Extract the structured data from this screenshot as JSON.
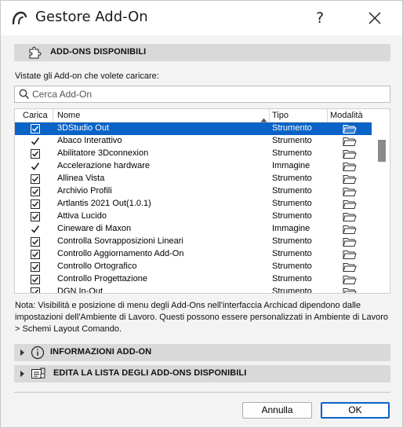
{
  "window": {
    "title": "Gestore Add-On",
    "help_label": "?"
  },
  "sections": {
    "available": "ADD-ONS DISPONIBILI",
    "info": "INFORMAZIONI ADD-ON",
    "edit_list": "EDITA LA LISTA DEGLI ADD-ONS DISPONIBILI"
  },
  "instructions": "Vistate gli Add-on che volete caricare:",
  "search": {
    "placeholder": "Cerca Add-On",
    "value": ""
  },
  "table": {
    "columns": [
      "Carica",
      "Nome",
      "Tipo",
      "Modalità"
    ],
    "sort_column": "Nome",
    "rows": [
      {
        "load": "checkbox-checked",
        "name": "3DStudio Out",
        "type": "Strumento",
        "mode": "folder-icon",
        "selected": true
      },
      {
        "load": "check",
        "name": "Abaco Interattivo",
        "type": "Strumento",
        "mode": "folder-icon"
      },
      {
        "load": "checkbox-checked",
        "name": "Abilitatore 3Dconnexion",
        "type": "Strumento",
        "mode": "folder-icon"
      },
      {
        "load": "check",
        "name": "Accelerazione hardware",
        "type": "Immagine",
        "mode": "folder-icon"
      },
      {
        "load": "checkbox-checked",
        "name": "Allinea Vista",
        "type": "Strumento",
        "mode": "folder-icon"
      },
      {
        "load": "checkbox-checked",
        "name": "Archivio Profili",
        "type": "Strumento",
        "mode": "folder-icon"
      },
      {
        "load": "checkbox-checked",
        "name": "Artlantis 2021 Out(1.0.1)",
        "type": "Strumento",
        "mode": "folder-icon"
      },
      {
        "load": "checkbox-checked",
        "name": "Attiva Lucido",
        "type": "Strumento",
        "mode": "folder-icon"
      },
      {
        "load": "check",
        "name": "Cineware di Maxon",
        "type": "Immagine",
        "mode": "folder-icon"
      },
      {
        "load": "checkbox-checked",
        "name": "Controlla Sovrapposizioni Lineari",
        "type": "Strumento",
        "mode": "folder-icon"
      },
      {
        "load": "checkbox-checked",
        "name": "Controllo Aggiornamento Add-On",
        "type": "Strumento",
        "mode": "folder-icon"
      },
      {
        "load": "checkbox-checked",
        "name": "Controllo Ortografico",
        "type": "Strumento",
        "mode": "folder-icon"
      },
      {
        "load": "checkbox-checked",
        "name": "Controllo Progettazione",
        "type": "Strumento",
        "mode": "folder-icon"
      },
      {
        "load": "checkbox-checked",
        "name": "DGN In-Out",
        "type": "Strumento",
        "mode": "folder-icon"
      }
    ],
    "scroll_position": 0.19
  },
  "note": "Nota: Visibilità e posizione di menu degli Add-Ons nell'interfaccia Archicad dipendono dalle impostazioni dell'Ambiente di Lavoro. Questi possono essere personalizzati in Ambiente di Lavoro > Schemi Layout Comando.",
  "buttons": {
    "cancel": "Annulla",
    "ok": "OK"
  },
  "colors": {
    "selection": "#0a63c6",
    "section_bar": "#d9d9d9",
    "window_bg": "#f3f3f3"
  }
}
